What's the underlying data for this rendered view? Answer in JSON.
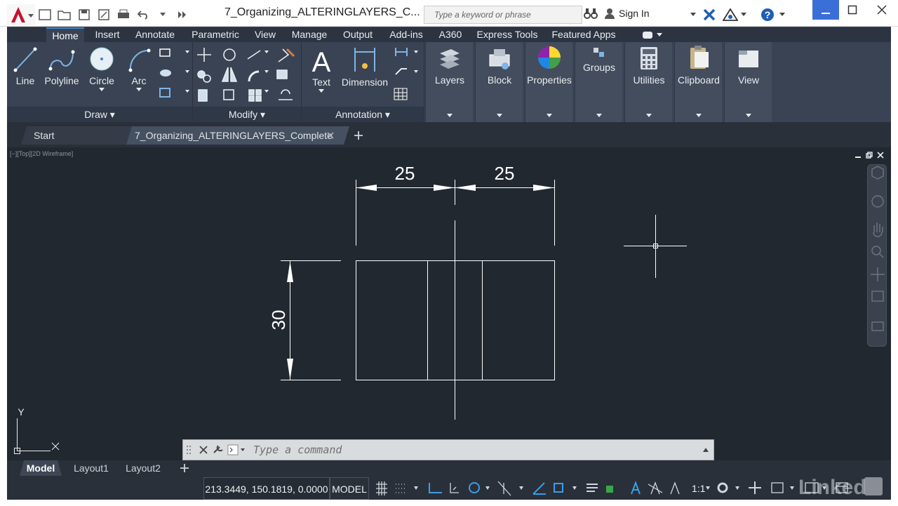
{
  "window": {
    "title": "7_Organizing_ALTERINGLAYERS_C...",
    "search_placeholder": "Type a keyword or phrase",
    "sign_in": "Sign In"
  },
  "ribbon_tabs": [
    "Home",
    "Insert",
    "Annotate",
    "Parametric",
    "View",
    "Manage",
    "Output",
    "Add-ins",
    "A360",
    "Express Tools",
    "Featured Apps"
  ],
  "ribbon": {
    "draw": {
      "title": "Draw",
      "tools": [
        "Line",
        "Polyline",
        "Circle",
        "Arc"
      ]
    },
    "modify": {
      "title": "Modify"
    },
    "annotation": {
      "title": "Annotation",
      "tools": [
        "Text",
        "Dimension"
      ]
    },
    "big_tools": [
      "Layers",
      "Block",
      "Properties",
      "Groups",
      "Utilities",
      "Clipboard",
      "View"
    ]
  },
  "file_tabs": {
    "start": "Start",
    "document": "7_Organizing_ALTERINGLAYERS_Complete"
  },
  "viewport": {
    "label": "[−][Top][2D Wireframe]"
  },
  "drawing": {
    "dim_top_left": "25",
    "dim_top_right": "25",
    "dim_left": "30",
    "ucs_y": "Y",
    "ucs_x": "X"
  },
  "command_line": {
    "placeholder": "Type a command"
  },
  "layout_tabs": [
    "Model",
    "Layout1",
    "Layout2"
  ],
  "status": {
    "coords": "213.3449, 150.1819, 0.0000",
    "model": "MODEL",
    "scale": "1:1"
  },
  "watermark": "Linked in",
  "colors": {
    "accent": "#3a84c5",
    "canvas": "#212830",
    "ribbon": "#394353"
  }
}
